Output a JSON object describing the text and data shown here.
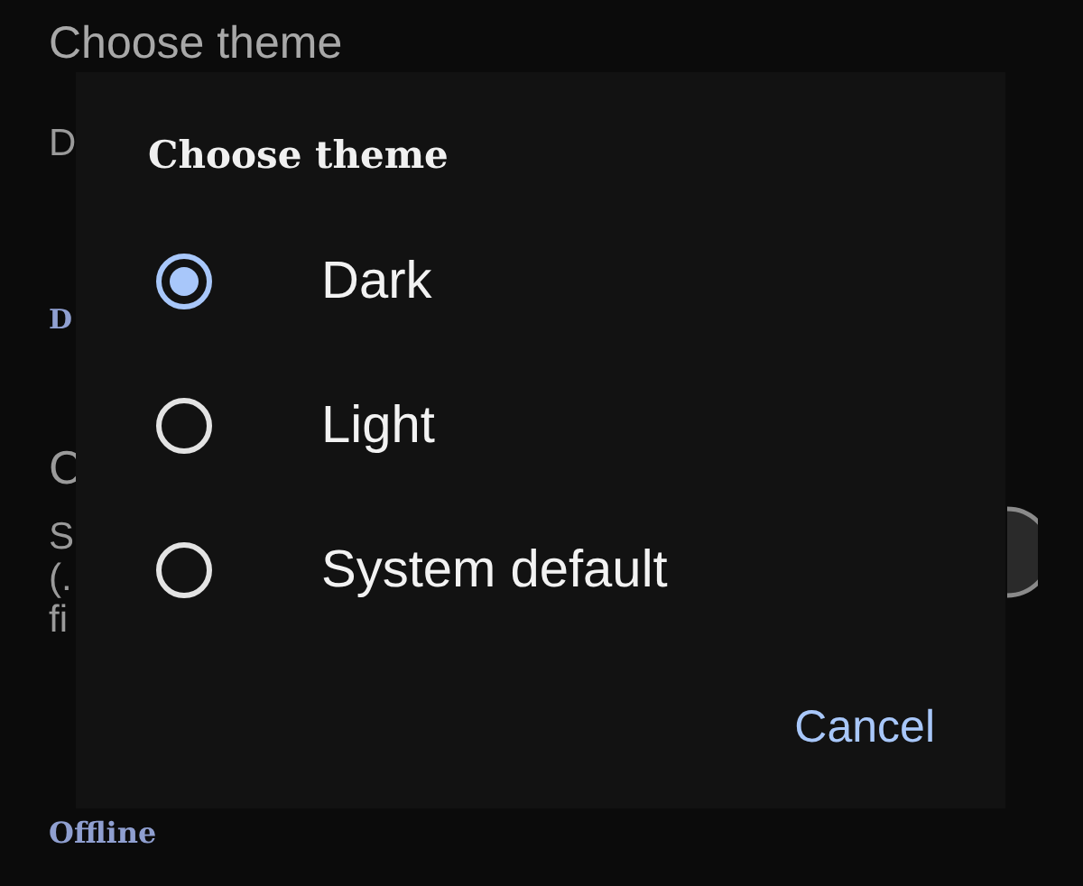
{
  "background": {
    "title": "Choose theme",
    "value": "D",
    "link": "D",
    "section_title": "C",
    "description_lines": [
      "S",
      "(.",
      "fi"
    ],
    "status_link": "Offline",
    "toggle": {
      "on": false
    }
  },
  "dialog": {
    "title": "Choose theme",
    "options": [
      {
        "label": "Dark",
        "selected": true
      },
      {
        "label": "Light",
        "selected": false
      },
      {
        "label": "System default",
        "selected": false
      }
    ],
    "cancel_button": "Cancel"
  }
}
